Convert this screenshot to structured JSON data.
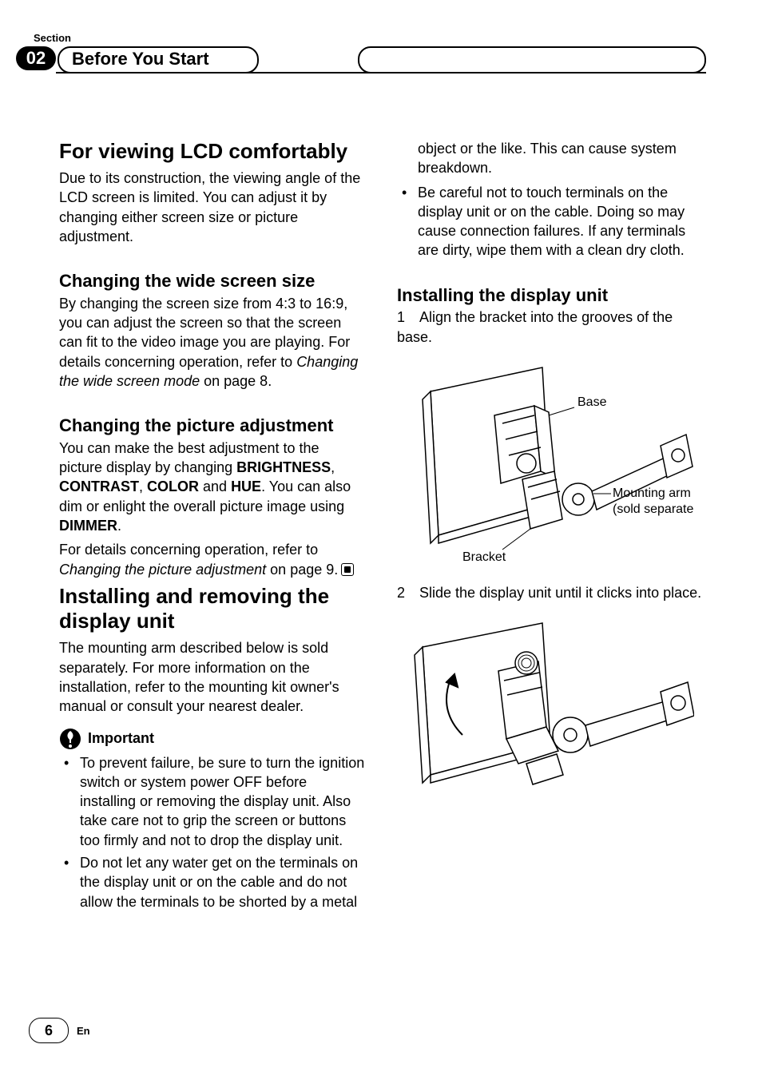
{
  "header": {
    "section_label": "Section",
    "section_number": "02",
    "chapter_title": "Before You Start"
  },
  "left": {
    "h1a": "For viewing LCD comfortably",
    "p1": "Due to its construction, the viewing angle of the LCD screen is limited. You can adjust it by changing either screen size or picture adjustment.",
    "h2a": "Changing the wide screen size",
    "p2a": "By changing the screen size from 4:3 to 16:9, you can adjust the screen so that the screen can fit to the video image you are playing. For details concerning operation, refer to ",
    "p2b_italic": "Changing the wide screen mode",
    "p2c": " on page 8.",
    "h2b": "Changing the picture adjustment",
    "p3a": "You can make the best adjustment to the picture display by changing ",
    "p3_brightness": "BRIGHTNESS",
    "p3b": ", ",
    "p3_contrast": "CONTRAST",
    "p3c": ", ",
    "p3_color": "COLOR",
    "p3d": " and ",
    "p3_hue": "HUE",
    "p3e": ". You can also dim or enlight the overall picture image using ",
    "p3_dimmer": "DIMMER",
    "p3f": ".",
    "p4a": "For details concerning operation, refer to ",
    "p4b_italic": "Changing the picture adjustment",
    "p4c": " on page 9.",
    "h1b": "Installing and removing the display unit",
    "p5": "The mounting arm described below is sold separately. For more information on the installation, refer to the mounting kit owner's manual or consult your nearest dealer.",
    "important_label": "Important",
    "bullets": [
      "To prevent failure, be sure to turn the ignition switch or system power OFF before installing or removing the display unit. Also take care not to grip the screen or buttons too firmly and not to drop the display unit.",
      "Do not let any water get on the terminals on the display unit or on the cable and do not allow the terminals to be shorted by a metal "
    ]
  },
  "right": {
    "bullets_cont": [
      "object or the like. This can cause system breakdown.",
      "Be careful not to touch terminals on the display unit or on the cable. Doing so may cause connection failures. If any terminals are dirty, wipe them with a clean dry cloth."
    ],
    "h2c": "Installing the display unit",
    "step1_num": "1",
    "step1": "Align the bracket into the grooves of the base.",
    "fig1": {
      "label_base": "Base",
      "label_arm1": "Mounting arm",
      "label_arm2": "(sold separately)",
      "label_bracket": "Bracket"
    },
    "step2_num": "2",
    "step2": "Slide the display unit until it clicks into place."
  },
  "footer": {
    "page": "6",
    "lang": "En"
  }
}
